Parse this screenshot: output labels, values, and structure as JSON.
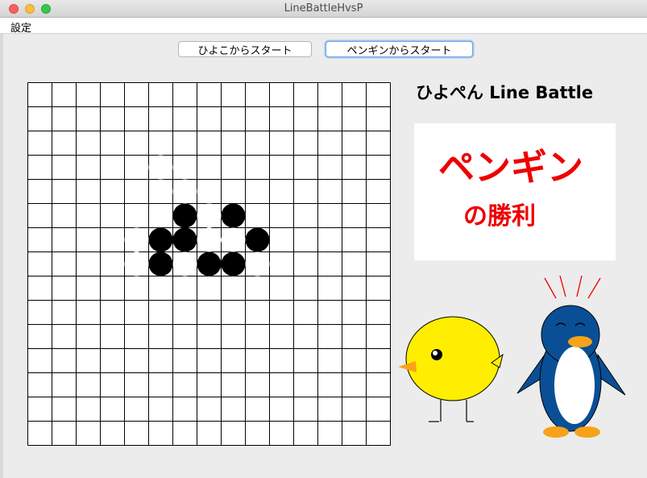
{
  "window": {
    "title": "LineBattleHvsP"
  },
  "menu": {
    "settings": "設定"
  },
  "buttons": {
    "start_hiyoko": "ひよこからスタート",
    "start_penguin": "ペンギンからスタート"
  },
  "app_title": "ひよぺん Line Battle",
  "result": {
    "winner": "ペンギン",
    "suffix": "の勝利"
  },
  "board": {
    "columns": 15,
    "rows": 15,
    "white_stones": [
      [
        5,
        3
      ],
      [
        6,
        4
      ],
      [
        7,
        5
      ],
      [
        4,
        6
      ],
      [
        7,
        6
      ],
      [
        8,
        6
      ],
      [
        4,
        7
      ],
      [
        6,
        7
      ],
      [
        9,
        7
      ]
    ],
    "black_stones": [
      [
        6,
        5
      ],
      [
        8,
        5
      ],
      [
        5,
        6
      ],
      [
        6,
        6
      ],
      [
        9,
        6
      ],
      [
        5,
        7
      ],
      [
        7,
        7
      ],
      [
        8,
        7
      ]
    ],
    "stone_colors": {
      "white": "#ffffff",
      "black": "#000000"
    }
  },
  "colors": {
    "result_text": "#ee0000",
    "chick_body": "#ffee00",
    "penguin_body": "#0a4f95"
  }
}
